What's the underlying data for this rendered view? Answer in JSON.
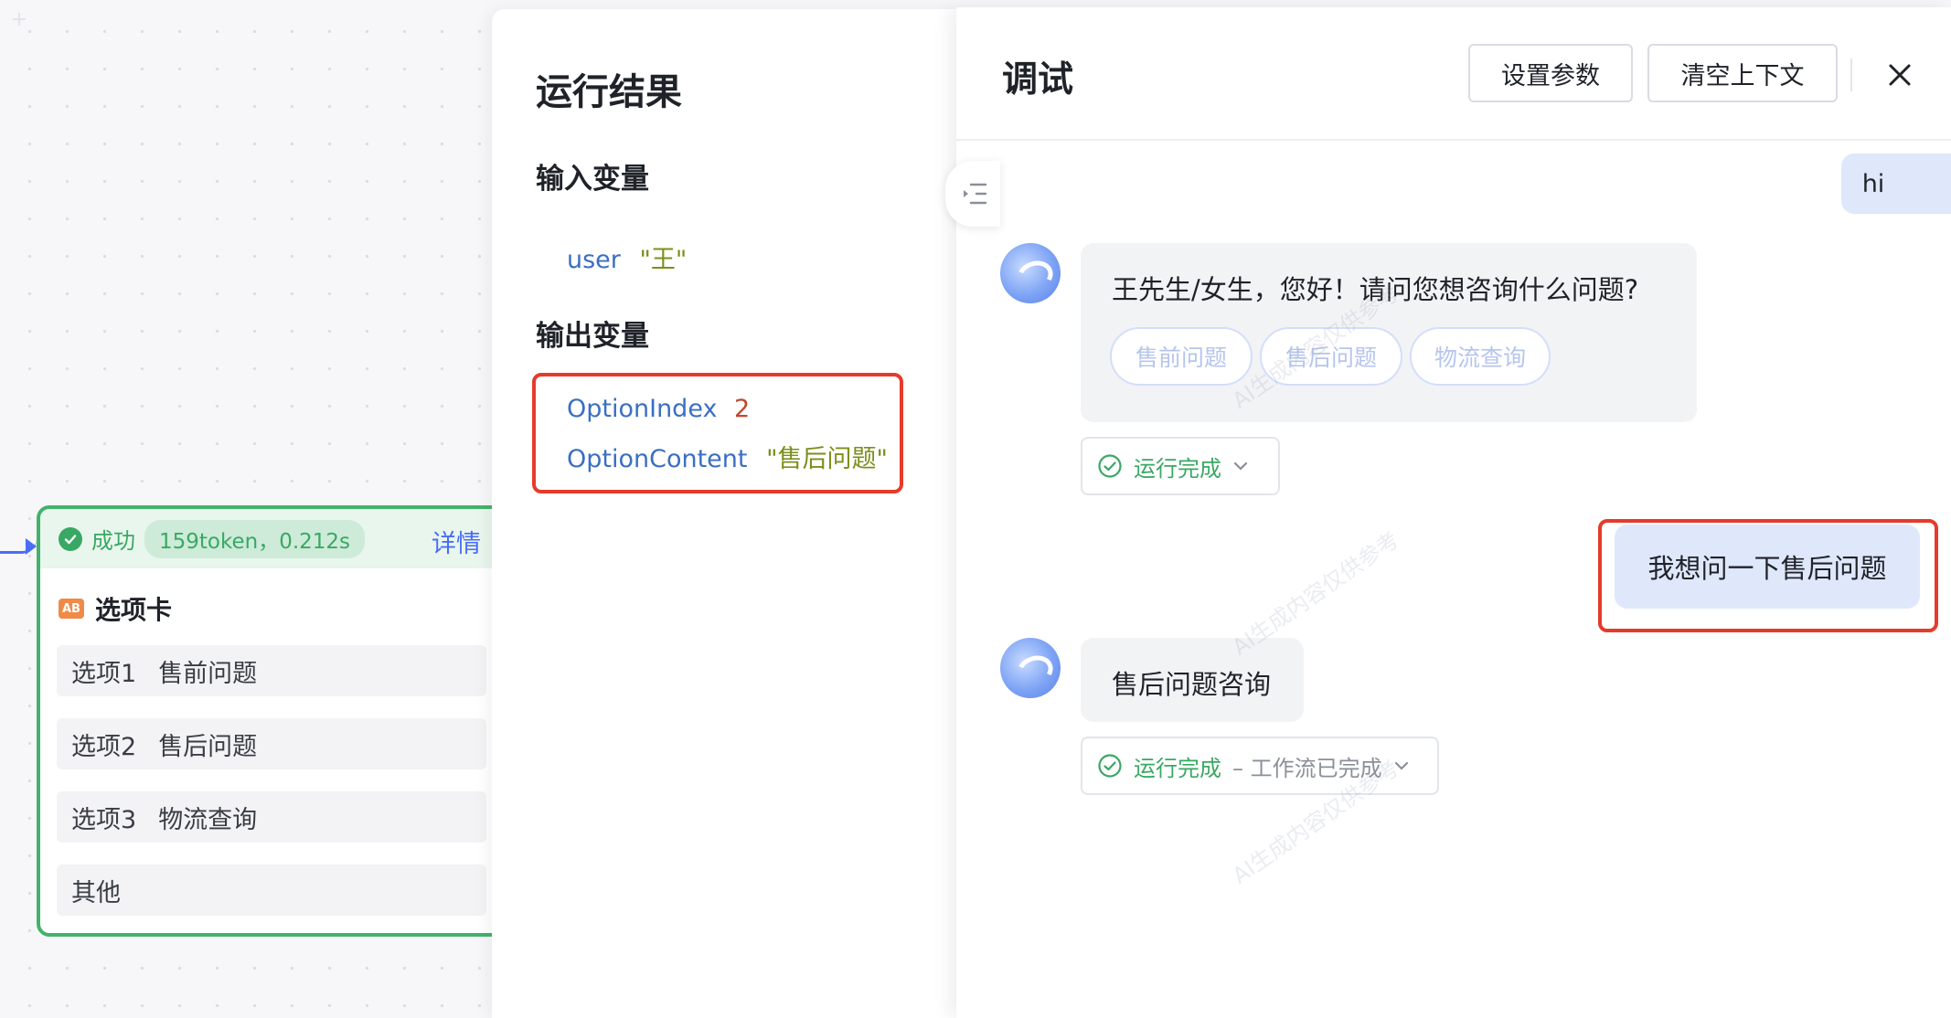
{
  "canvas": {
    "node": {
      "status": "成功",
      "stats": "159token，0.212s",
      "detail_link": "详情",
      "title": "选项卡",
      "type_badge": "AB",
      "options": [
        {
          "label": "选项1",
          "value": "售前问题"
        },
        {
          "label": "选项2",
          "value": "售后问题"
        },
        {
          "label": "选项3",
          "value": "物流查询"
        },
        {
          "label": "其他",
          "value": ""
        }
      ]
    }
  },
  "result_panel": {
    "title": "运行结果",
    "input_section": "输入变量",
    "inputs": [
      {
        "key": "user",
        "value": "\"王\""
      }
    ],
    "output_section": "输出变量",
    "outputs": [
      {
        "key": "OptionIndex",
        "value": "2"
      },
      {
        "key": "OptionContent",
        "value": "\"售后问题\""
      }
    ]
  },
  "debug_panel": {
    "title": "调试",
    "set_params_button": "设置参数",
    "clear_context_button": "清空上下文",
    "messages": {
      "user_1": "hi",
      "bot_1": "王先生/女生，您好！请问您想咨询什么问题?",
      "bot_1_chips": [
        "售前问题",
        "售后问题",
        "物流查询"
      ],
      "bot_1_status": "运行完成",
      "user_2": "我想问一下售后问题",
      "bot_2": "售后问题咨询",
      "bot_2_status": "运行完成",
      "bot_2_status_detail": "– 工作流已完成"
    },
    "watermark": "AI生成内容仅供参考"
  },
  "colors": {
    "success": "#3aa865",
    "accent": "#4a6cf7",
    "highlight": "#e53b2c",
    "user_bubble": "#dfe7fb"
  }
}
